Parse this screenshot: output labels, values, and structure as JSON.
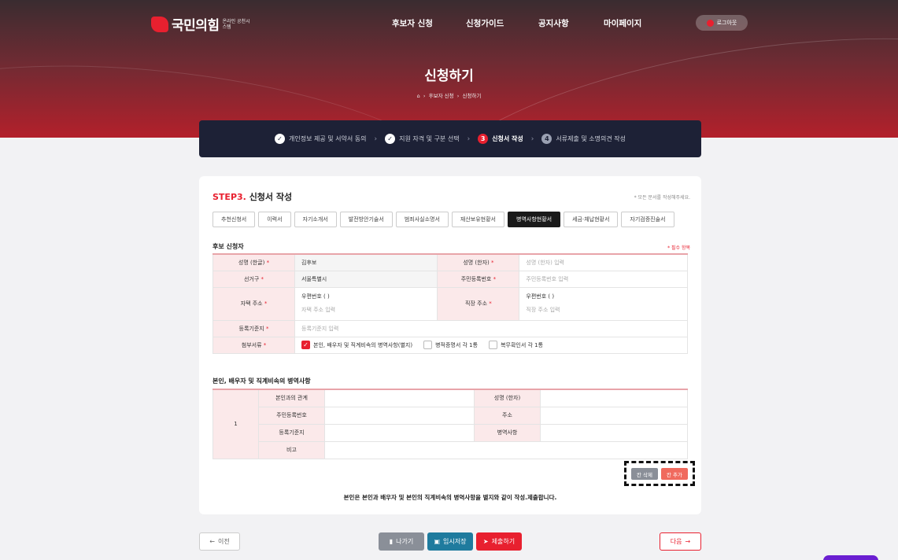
{
  "brand": {
    "name": "국민의힘",
    "sub": "온라인 공천시스템",
    "accent": "#e8202f"
  },
  "nav": {
    "items": [
      "후보자 신청",
      "신청가이드",
      "공지사항",
      "마이페이지"
    ],
    "logout": "로그아웃"
  },
  "header": {
    "title": "신청하기",
    "breadcrumb": [
      "후보자 신청",
      "신청하기"
    ]
  },
  "steps": [
    {
      "label": "개인정보 제공 및 서약서 동의",
      "state": "done"
    },
    {
      "label": "지원 자격 및 구분 선택",
      "state": "done"
    },
    {
      "label": "신청서 작성",
      "state": "active",
      "num": "3"
    },
    {
      "label": "서류제출 및 소명의견 작성",
      "state": "pending",
      "num": "4"
    }
  ],
  "form": {
    "step_prefix": "STEP3.",
    "step_title": "신청서 작성",
    "top_note": "* 모든 문서를 작성해주세요.",
    "tabs": [
      "추천신청서",
      "이력서",
      "자기소개서",
      "발전방안기술서",
      "범죄사실소명서",
      "재산보유현황서",
      "병역사항현황서",
      "세금·체납현황서",
      "자기검증진술서"
    ],
    "active_tab": "병역사항현황서",
    "applicant_section": "후보 신청자",
    "required_note": "* 필수 항목",
    "fields": {
      "name_kr_label": "성명 (한글)",
      "name_kr_value": "김후보",
      "name_hanja_label": "성명 (한자)",
      "name_hanja_placeholder": "성명 (한자) 입력",
      "district_label": "선거구",
      "district_value": "서울특별시",
      "rrn_label": "주민등록번호",
      "rrn_placeholder": "주민등록번호 입력",
      "home_addr_label": "자택 주소",
      "home_postcode": "우편번호 (                )",
      "home_addr_placeholder": "자택 주소 입력",
      "work_addr_label": "직장 주소",
      "work_postcode": "우편번호 (                )",
      "work_addr_placeholder": "직장 주소 입력",
      "domicile_label": "등록기준지",
      "domicile_placeholder": "등록기준지 입력",
      "attach_label": "첨부서류",
      "attachments": [
        {
          "label": "본인, 배우자 및 직계비속의 병역사항(별지)",
          "checked": true
        },
        {
          "label": "병적증명서 각 1통",
          "checked": false
        },
        {
          "label": "복무확인서 각 1통",
          "checked": false
        }
      ]
    },
    "military_section": "본인, 배우자 및 직계비속의 병역사항",
    "military": {
      "row_num": "1",
      "relation_label": "본인과의 관계",
      "hanja_label": "성명 (한자)",
      "rrn_label": "주민등록번호",
      "address_label": "주소",
      "domicile_label": "등록기준지",
      "service_label": "병역사항",
      "remark_label": "비고"
    },
    "delete_row_btn": "칸 삭제",
    "add_row_btn": "칸 추가",
    "bottom_note": "본인은 본인과 배우자 및 본인의 직계비속의 병역사항을 별지와 같이 작성.제출합니다."
  },
  "footer_buttons": {
    "prev": "이전",
    "exit": "나가기",
    "save": "임시저장",
    "submit": "제출하기",
    "next": "다음"
  }
}
